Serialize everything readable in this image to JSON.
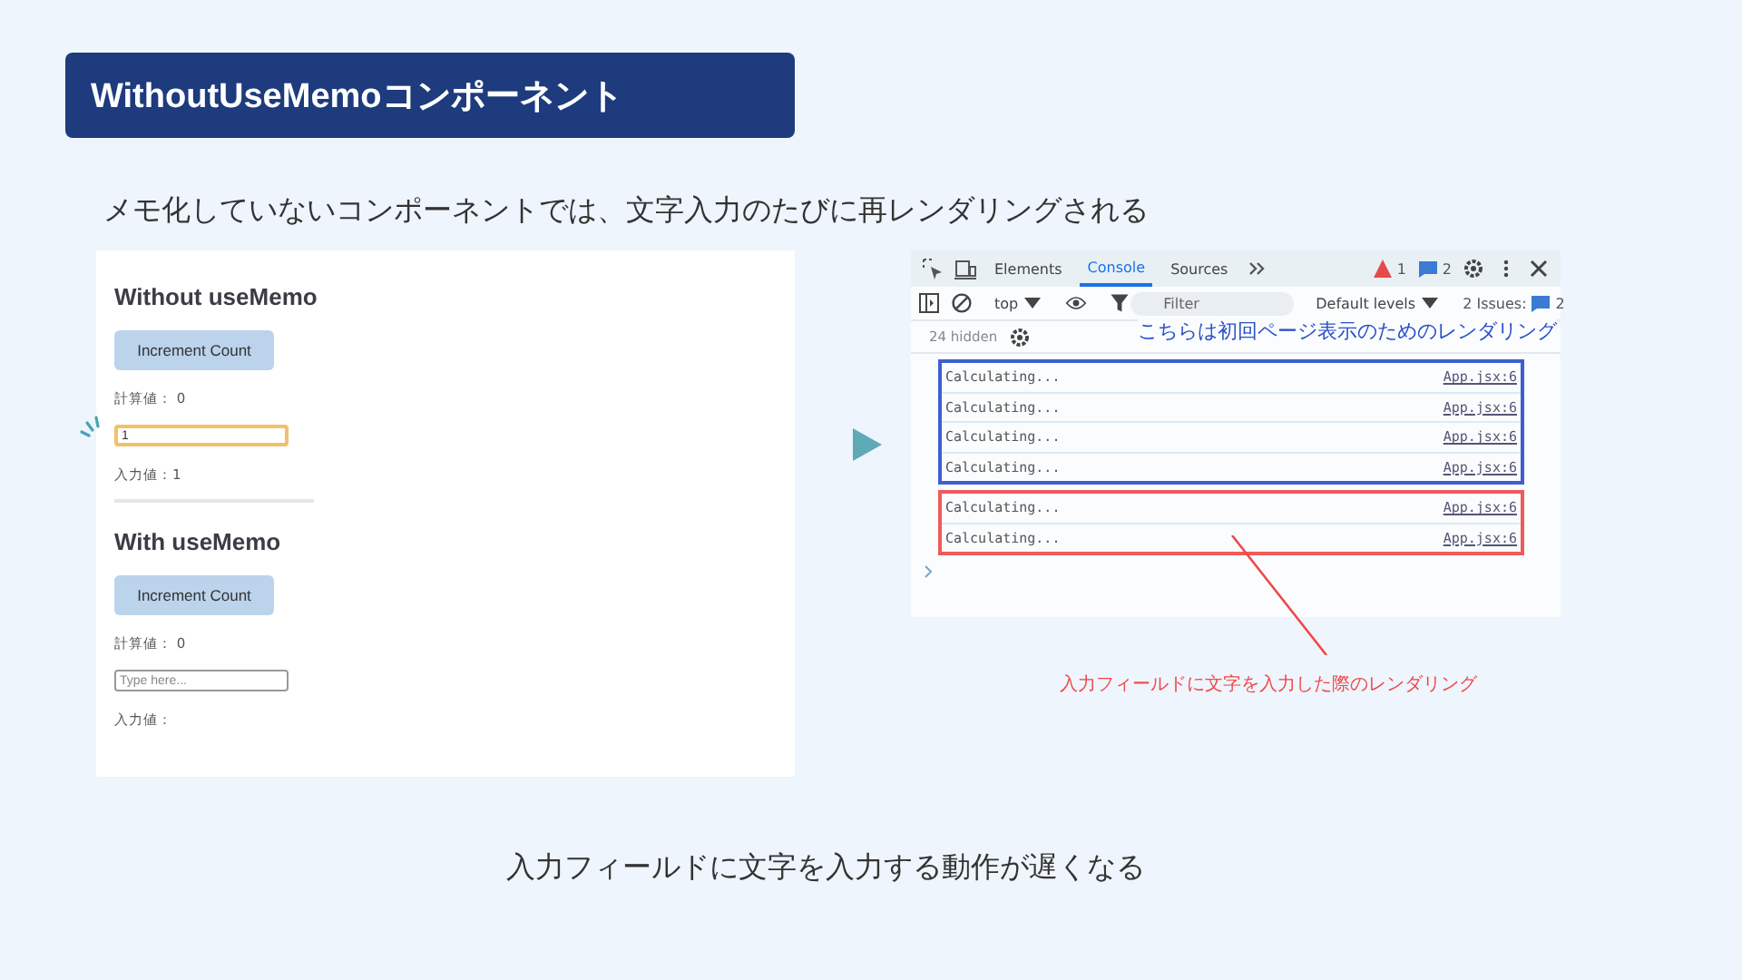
{
  "title": "WithoutUseMemoコンポーネント",
  "subtitle": "メモ化していないコンポーネントでは、文字入力のたびに再レンダリングされる",
  "demo_app": {
    "sections": [
      {
        "heading": "Without useMemo",
        "button": "Increment Count",
        "computed": "計算値： 0",
        "input": {
          "value": "1",
          "focused": true
        },
        "echo": "入力値：1"
      },
      {
        "heading": "With useMemo",
        "button": "Increment Count",
        "computed": "計算値： 0",
        "input": {
          "placeholder": "Type here...",
          "focused": false
        },
        "echo": "入力値："
      }
    ]
  },
  "devtools": {
    "tabs": [
      {
        "label": "Elements",
        "selected": false
      },
      {
        "label": "Console",
        "selected": true
      },
      {
        "label": "Sources",
        "selected": false
      }
    ],
    "warnings": "1",
    "messages": "2",
    "context": "top",
    "filter": {
      "placeholder": "Filter"
    },
    "levels": "Default levels",
    "issues_label": "2 Issues:",
    "issues_count": "2",
    "hidden": "24 hidden",
    "log_groups": [
      {
        "kind": "initial",
        "note": "こちらは初回ページ表示のためのレンダリング",
        "logs": [
          {
            "text": "Calculating...",
            "source": "App.jsx:6"
          },
          {
            "text": "Calculating...",
            "source": "App.jsx:6"
          },
          {
            "text": "Calculating...",
            "source": "App.jsx:6"
          },
          {
            "text": "Calculating...",
            "source": "App.jsx:6"
          }
        ]
      },
      {
        "kind": "typing",
        "note": "入力フィールドに文字を入力した際のレンダリング",
        "logs": [
          {
            "text": "Calculating...",
            "source": "App.jsx:6"
          },
          {
            "text": "Calculating...",
            "source": "App.jsx:6"
          }
        ]
      }
    ]
  },
  "caption": "入力フィールドに文字を入力する動作が遅くなる"
}
